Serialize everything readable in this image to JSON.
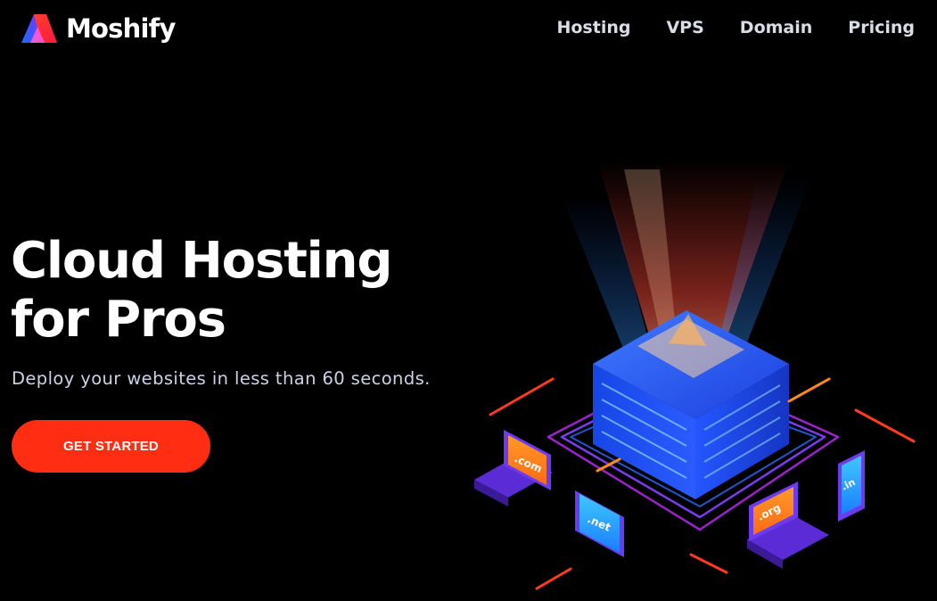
{
  "brand": {
    "name": "Moshify",
    "logo_icon": "moshify-logo-icon"
  },
  "nav": {
    "items": [
      "Hosting",
      "VPS",
      "Domain",
      "Pricing"
    ]
  },
  "hero": {
    "title_line1": "Cloud Hosting",
    "title_line2": "for Pros",
    "subtitle": "Deploy your websites in less than 60 seconds.",
    "cta_label": "GET STARTED"
  },
  "illustration": {
    "domains": [
      ".com",
      ".net",
      ".org",
      ".in"
    ]
  },
  "colors": {
    "background": "#000000",
    "accent": "#ff2d11",
    "text": "#ffffff",
    "nav_text": "#d9dde6",
    "subtitle_text": "#c9d3e6",
    "server_blue": "#1f4bff",
    "laptop_purple": "#7b3cf0",
    "screen_orange": "#ff8a1c"
  }
}
